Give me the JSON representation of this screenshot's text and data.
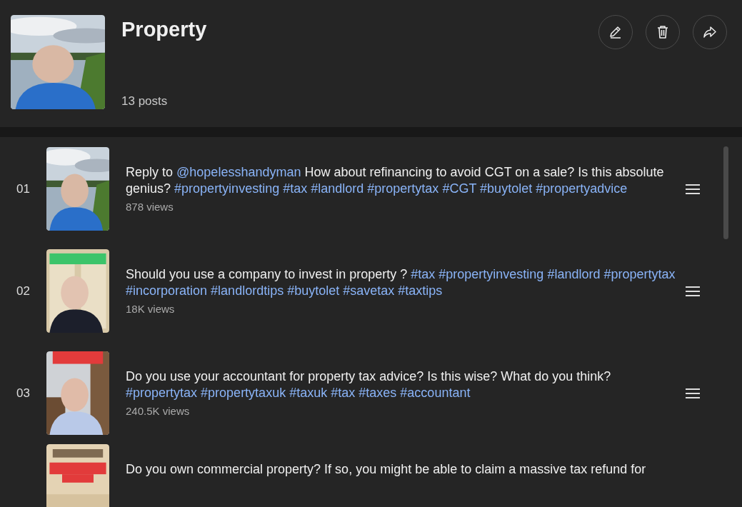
{
  "playlist": {
    "title": "Property",
    "post_count": "13 posts",
    "actions": [
      {
        "kind": "edit"
      },
      {
        "kind": "delete"
      },
      {
        "kind": "share"
      }
    ]
  },
  "posts": [
    {
      "number": "01",
      "parts": [
        {
          "kind": "text",
          "text": "Reply to"
        },
        {
          "kind": "link",
          "text": "@hopelesshandyman"
        },
        {
          "kind": "text",
          "text": "How about refinancing to avoid CGT on a sale? Is this absolute genius?"
        },
        {
          "kind": "link",
          "text": "#propertyinvesting"
        },
        {
          "kind": "link",
          "text": "#tax"
        },
        {
          "kind": "link",
          "text": "#landlord"
        },
        {
          "kind": "link",
          "text": "#propertytax"
        },
        {
          "kind": "link",
          "text": "#CGT"
        },
        {
          "kind": "link",
          "text": "#buytolet"
        },
        {
          "kind": "link",
          "text": "#propertyadvice"
        }
      ],
      "views": "878 views"
    },
    {
      "number": "02",
      "parts": [
        {
          "kind": "text",
          "text": "Should you use a company to invest in property ?"
        },
        {
          "kind": "link",
          "text": "#tax"
        },
        {
          "kind": "link",
          "text": "#propertyinvesting"
        },
        {
          "kind": "link",
          "text": "#landlord"
        },
        {
          "kind": "link",
          "text": "#propertytax"
        },
        {
          "kind": "link",
          "text": "#incorporation"
        },
        {
          "kind": "link",
          "text": "#landlordtips"
        },
        {
          "kind": "link",
          "text": "#buytolet"
        },
        {
          "kind": "link",
          "text": "#savetax"
        },
        {
          "kind": "link",
          "text": "#taxtips"
        }
      ],
      "views": "18K views"
    },
    {
      "number": "03",
      "parts": [
        {
          "kind": "text",
          "text": "Do you use your accountant for property tax advice? Is this wise? What do you think?"
        },
        {
          "kind": "link",
          "text": "#propertytax"
        },
        {
          "kind": "link",
          "text": "#propertytaxuk"
        },
        {
          "kind": "link",
          "text": "#taxuk"
        },
        {
          "kind": "link",
          "text": "#tax"
        },
        {
          "kind": "link",
          "text": "#taxes"
        },
        {
          "kind": "link",
          "text": "#accountant"
        }
      ],
      "views": "240.5K views"
    },
    {
      "parts": [
        {
          "kind": "text",
          "text": "Do you own commercial property? If so, you might be able to claim a massive tax refund for"
        }
      ]
    }
  ]
}
